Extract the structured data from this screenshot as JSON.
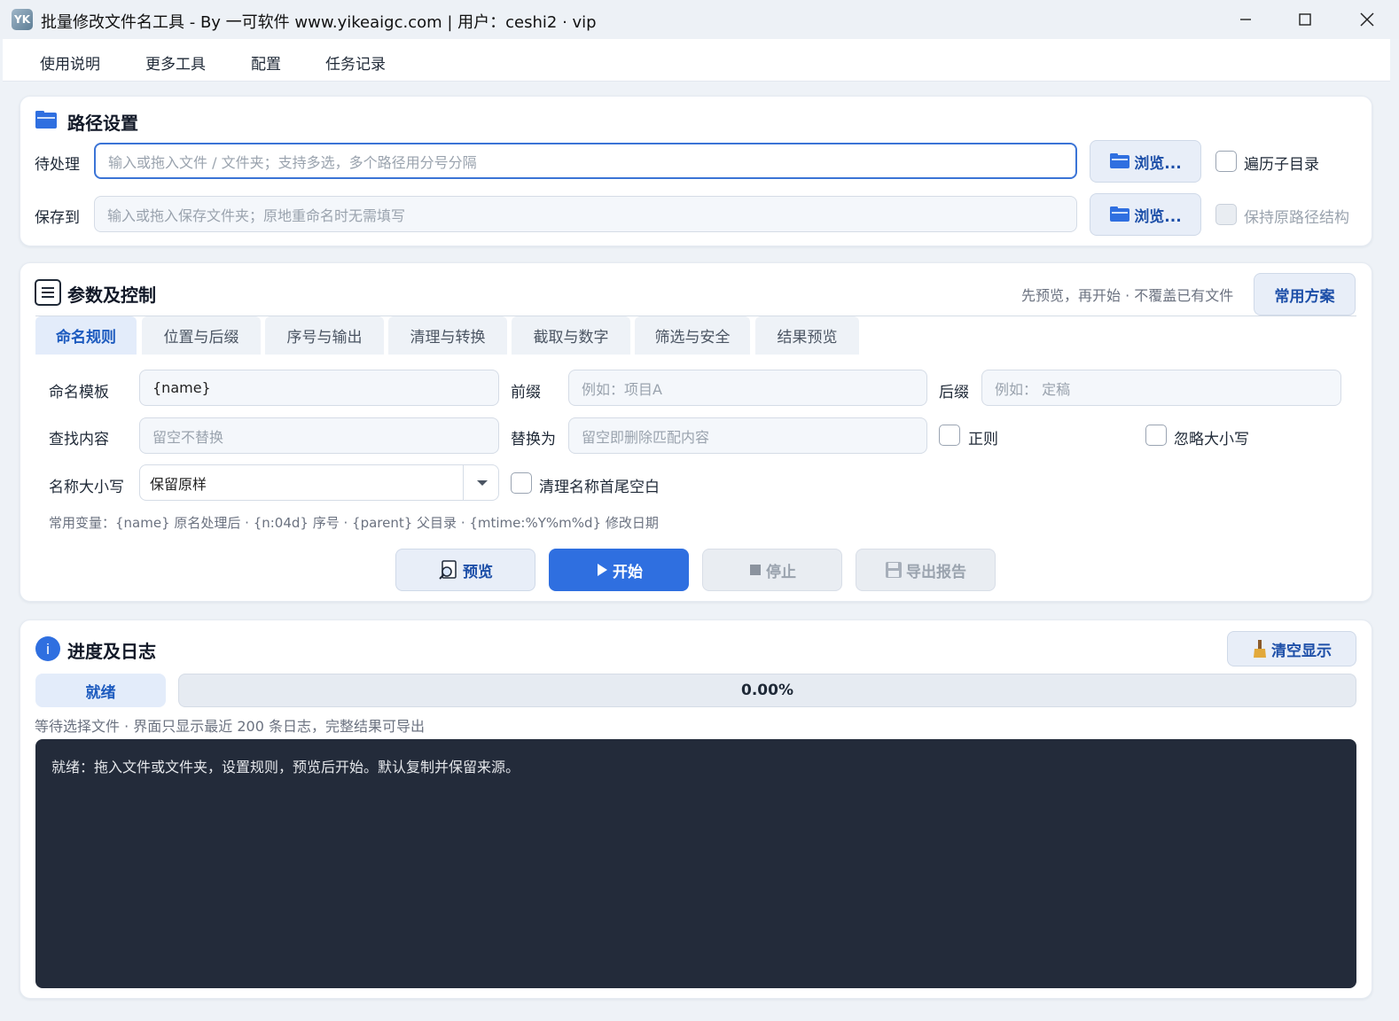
{
  "window": {
    "title": "批量修改文件名工具 - By 一可软件 www.yikeaigc.com | 用户：ceshi2 · vip",
    "app_icon_text": "YK"
  },
  "menu": {
    "items": [
      "使用说明",
      "更多工具",
      "配置",
      "任务记录"
    ]
  },
  "path_section": {
    "title": "路径设置",
    "input_label": "待处理",
    "input_placeholder": "输入或拖入文件 / 文件夹；支持多选，多个路径用分号分隔",
    "output_label": "保存到",
    "output_placeholder": "输入或拖入保存文件夹；原地重命名时无需填写",
    "browse_label": "浏览...",
    "traverse_label": "遍历子目录",
    "keep_structure_label": "保持原路径结构"
  },
  "params_section": {
    "title": "参数及控制",
    "hint": "先预览，再开始 · 不覆盖已有文件",
    "scheme_button": "常用方案",
    "tabs": [
      "命名规则",
      "位置与后缀",
      "序号与输出",
      "清理与转换",
      "截取与数字",
      "筛选与安全",
      "结果预览"
    ],
    "template_label": "命名模板",
    "template_value": "{name}",
    "prefix_label": "前缀",
    "prefix_placeholder": "例如：项目A",
    "suffix_label": "后缀",
    "suffix_placeholder": "例如： 定稿",
    "find_label": "查找内容",
    "find_placeholder": "留空不替换",
    "replace_label": "替换为",
    "replace_placeholder": "留空即删除匹配内容",
    "regex_label": "正则",
    "ignore_case_label": "忽略大小写",
    "case_label": "名称大小写",
    "case_value": "保留原样",
    "trim_label": "清理名称首尾空白",
    "variables_hint": "常用变量：{name} 原名处理后 · {n:04d} 序号 · {parent} 父目录 · {mtime:%Y%m%d} 修改日期",
    "preview_button": "预览",
    "start_button": "开始",
    "stop_button": "停止",
    "export_button": "导出报告"
  },
  "progress_section": {
    "title": "进度及日志",
    "clear_button": "清空显示",
    "status": "就绪",
    "progress": 0.0,
    "progress_text": "0.00%",
    "info": "等待选择文件 · 界面只显示最近 200 条日志，完整结果可导出",
    "log_text": "就绪：拖入文件或文件夹，设置规则，预览后开始。默认复制并保留来源。"
  },
  "colors": {
    "accent": "#2f6fe0",
    "log_bg": "#232b3a"
  }
}
